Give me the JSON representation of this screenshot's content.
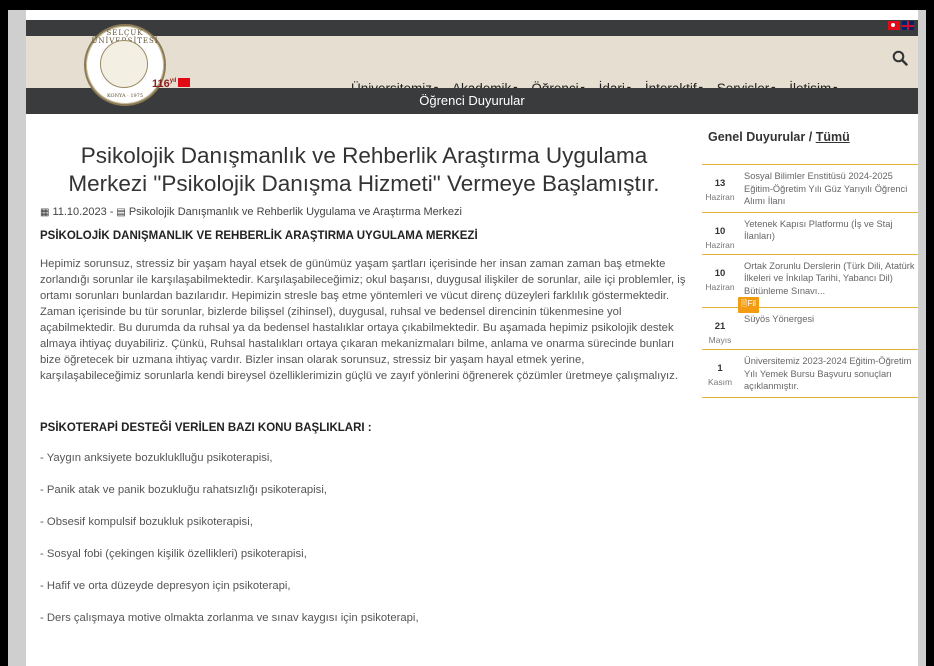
{
  "topbar": {
    "flags": [
      "turkish-flag-icon",
      "english-flag-icon"
    ]
  },
  "logo": {
    "ring_text": "SELÇUK ÜNİVERSİTESİ",
    "bottom_text": "KONYA · 1975",
    "badge": "116",
    "badge_sup": "yıl"
  },
  "menu": [
    {
      "label": "Üniversitemiz"
    },
    {
      "label": "Akademik"
    },
    {
      "label": "Öğrenci"
    },
    {
      "label": "İdari"
    },
    {
      "label": "İnteraktif"
    },
    {
      "label": "Servisler"
    },
    {
      "label": "İletişim"
    }
  ],
  "section_bar": {
    "title": "Öğrenci Duyurular"
  },
  "article": {
    "title": "Psikolojik Danışmanlık ve Rehberlik Araştırma Uygulama Merkezi \"Psikolojik Danışma Hizmeti\" Vermeye Başlamıştır.",
    "date": "11.10.2023",
    "separator": "-",
    "source": "Psikolojik Danışmanlık ve Rehberlik Uygulama ve Araştırma Merkezi",
    "heading": "PSİKOLOJİK DANIŞMANLIK VE REHBERLİK ARAŞTIRMA UYGULAMA MERKEZİ",
    "paragraph": "Hepimiz sorunsuz, stressiz bir yaşam hayal etsek de günümüz yaşam şartları içerisinde her insan zaman zaman baş etmekte zorlandığı sorunlar ile karşılaşabilmektedir. Karşılaşabileceğimiz; okul başarısı, duygusal ilişkiler de sorunlar, aile içi problemler, iş ortamı sorunları bunlardan bazılarıdır. Hepimizin stresle baş etme yöntemleri ve vücut direnç düzeyleri farklılık göstermektedir. Zaman içerisinde bu tür sorunlar, bizlerde bilişsel (zihinsel), duygusal, ruhsal ve bedensel direncinin tükenmesine yol açabilmektedir. Bu durumda da ruhsal ya da bedensel hastalıklar ortaya çıkabilmektedir. Bu aşamada hepimiz psikolojik destek almaya ihtiyaç duyabiliriz. Çünkü, Ruhsal hastalıkları ortaya çıkaran mekanizmaları bilme, anlama ve onarma sürecinde bunları bize öğretecek bir uzmana ihtiyaç vardır. Bizler insan olarak sorunsuz, stressiz bir yaşam hayal etmek yerine, karşılaşabileceğimiz sorunlarla kendi bireysel özelliklerimizin güçlü ve zayıf yönlerini öğrenerek çözümler üretmeye çalışmalıyız.",
    "heading2": "PSİKOTERAPİ DESTEĞİ VERİLEN BAZI KONU BAŞLIKLARI :",
    "list": [
      "- Yaygın anksiyete bozukluklluğu psikoterapisi,",
      "- Panik atak ve panik bozukluğu rahatsızlığı psikoterapisi,",
      "- Obsesif kompulsif bozukluk psikoterapisi,",
      "- Sosyal fobi (çekingen kişilik özellikleri) psikoterapisi,",
      "- Hafif ve orta düzeyde depresyon için psikoterapi,",
      "- Ders çalışmaya motive olmakta zorlanma ve sınav kaygısı için psikoterapi,"
    ]
  },
  "sidebar": {
    "title": "Genel Duyurular /",
    "all_link": "Tümü",
    "items": [
      {
        "day": "13",
        "month": "Haziran",
        "text": "Sosyal Bilimler Enstitüsü 2024-2025 Eğitim-Öğretim Yılı Güz Yarıyılı Öğrenci Alımı İlanı"
      },
      {
        "day": "10",
        "month": "Haziran",
        "text": "Yetenek Kapısı Platformu (İş ve Staj İlanları)"
      },
      {
        "day": "10",
        "month": "Haziran",
        "text": "Ortak Zorunlu Derslerin (Türk Dili, Atatürk İlkeleri ve İnkılap Tarihi, Yabancı Dil) Bütünleme Sınavı...",
        "badge": "Fil"
      },
      {
        "day": "21",
        "month": "Mayıs",
        "text": "Süyös Yönergesi"
      },
      {
        "day": "1",
        "month": "Kasım",
        "text": "Üniversitemiz 2023-2024 Eğitim-Öğretim Yılı Yemek Bursu Başvuru sonuçları açıklanmıştır."
      }
    ]
  }
}
